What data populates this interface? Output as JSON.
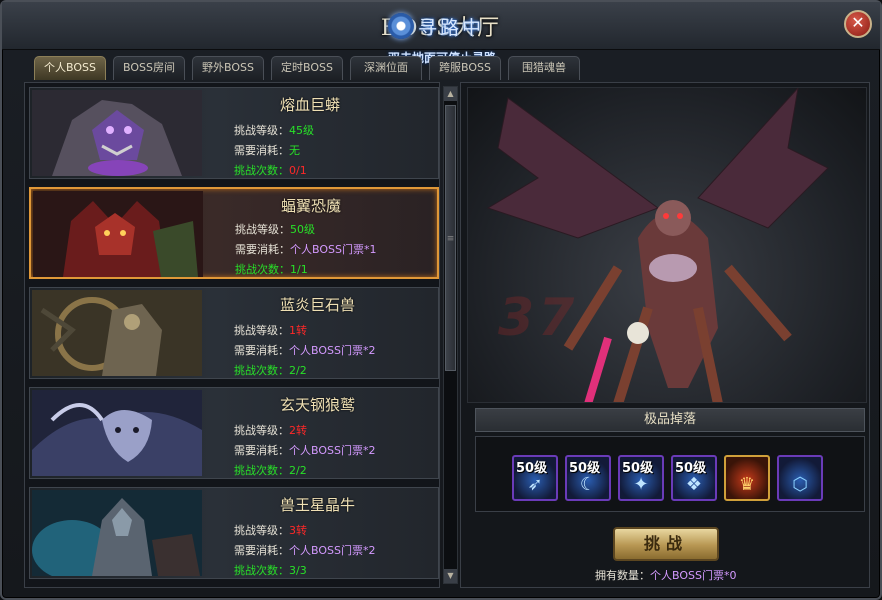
{
  "window": {
    "title": "BOSS大厅",
    "close_glyph": "✕"
  },
  "autopath": {
    "label": "寻路中",
    "hint": "双击地面可停止寻路"
  },
  "tabs": [
    {
      "label": "个人BOSS",
      "active": true
    },
    {
      "label": "BOSS房间"
    },
    {
      "label": "野外BOSS"
    },
    {
      "label": "定时BOSS"
    },
    {
      "label": "深渊位面"
    },
    {
      "label": "跨服BOSS"
    },
    {
      "label": "围猎魂兽"
    }
  ],
  "labels": {
    "level": "挑战等级：",
    "cost": "需要消耗：",
    "count": "挑战次数："
  },
  "bosses": [
    {
      "name": "熔血巨蟒",
      "level": "45级",
      "cost": "无",
      "count": "0/1",
      "theme": "#4a2a6a"
    },
    {
      "name": "蝠翼恐魔",
      "level": "50级",
      "cost": "个人BOSS门票*1",
      "count": "1/1",
      "theme": "#6a1a1a",
      "selected": true
    },
    {
      "name": "蓝炎巨石兽",
      "level": "1转",
      "cost": "个人BOSS门票*2",
      "count": "2/2",
      "theme": "#5a4a2a"
    },
    {
      "name": "玄天钢狼鹫",
      "level": "2转",
      "cost": "个人BOSS门票*2",
      "count": "2/2",
      "theme": "#2a3a6a"
    },
    {
      "name": "兽王星晶牛",
      "level": "3转",
      "cost": "个人BOSS门票*2",
      "count": "3/3",
      "theme": "#1a4a5a"
    }
  ],
  "scroll": {
    "up": "▲",
    "down": "▼",
    "grip": "≡"
  },
  "stage": {
    "watermark": "37"
  },
  "drops": {
    "header": "极品掉落",
    "items": [
      {
        "level": "50级",
        "icon": "sword-icon",
        "glyph": "➶"
      },
      {
        "level": "50级",
        "icon": "crescent-blade-icon",
        "glyph": "☾"
      },
      {
        "level": "50级",
        "icon": "armor-icon",
        "glyph": "✦"
      },
      {
        "level": "50级",
        "icon": "crystal-blade-icon",
        "glyph": "❖"
      },
      {
        "level": "",
        "icon": "red-helmet-icon",
        "glyph": "♛"
      },
      {
        "level": "",
        "icon": "blue-gem-icon",
        "glyph": "⬡"
      }
    ]
  },
  "challenge": {
    "label": "挑战",
    "owned_label": "拥有数量：",
    "owned_value": "个人BOSS门票*0"
  }
}
